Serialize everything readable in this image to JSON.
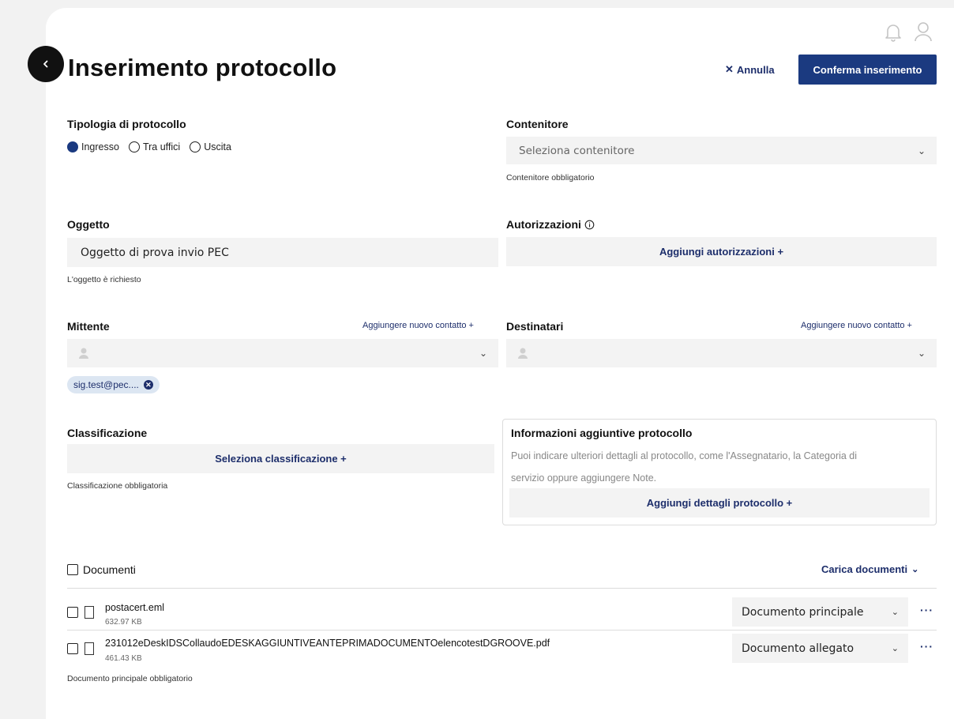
{
  "header": {
    "title": "Inserimento protocollo",
    "cancel_label": "Annulla",
    "confirm_label": "Conferma inserimento"
  },
  "tipologia": {
    "label": "Tipologia di protocollo",
    "options": [
      "Ingresso",
      "Tra uffici",
      "Uscita"
    ],
    "selected": "Ingresso"
  },
  "contenitore": {
    "label": "Contenitore",
    "placeholder": "Seleziona contenitore",
    "hint": "Contenitore obbligatorio"
  },
  "oggetto": {
    "label": "Oggetto",
    "value": "Oggetto di prova invio PEC",
    "hint": "L'oggetto è richiesto"
  },
  "autorizzazioni": {
    "label": "Autorizzazioni",
    "action": "Aggiungi autorizzazioni +"
  },
  "mittente": {
    "label": "Mittente",
    "add_contact": "Aggiungere nuovo contatto +",
    "chip": "sig.test@pec...."
  },
  "destinatari": {
    "label": "Destinatari",
    "add_contact": "Aggiungere nuovo contatto +"
  },
  "classificazione": {
    "label": "Classificazione",
    "action": "Seleziona classificazione +",
    "hint": "Classificazione obbligatoria"
  },
  "info_aggiuntive": {
    "title": "Informazioni aggiuntive protocollo",
    "line1": "Puoi indicare ulteriori dettagli al protocollo, come l'Assegnatario, la Categoria di",
    "line2": "servizio oppure aggiungere Note.",
    "action": "Aggiungi dettagli protocollo +"
  },
  "documenti": {
    "label": "Documenti",
    "upload": "Carica documenti",
    "items": [
      {
        "name": "postacert.eml",
        "size": "632.97 KB",
        "type": "Documento principale"
      },
      {
        "name": "231012eDeskIDSCollaudoEDESKAGGIUNTIVEANTEPRIMADOCUMENTOelencotestDGROOVE.pdf",
        "size": "461.43 KB",
        "type": "Documento allegato"
      }
    ],
    "hint": "Documento principale obbligatorio"
  },
  "icons": {
    "back": "chevron-left-icon",
    "bell": "bell-icon",
    "user": "user-icon",
    "info": "info-icon",
    "close": "close-icon",
    "person": "person-placeholder-icon",
    "doc": "document-icon"
  },
  "colors": {
    "primary": "#1b3a80",
    "link": "#1d2e6b",
    "field_bg": "#f3f3f3",
    "chip_bg": "#dce6f2"
  }
}
